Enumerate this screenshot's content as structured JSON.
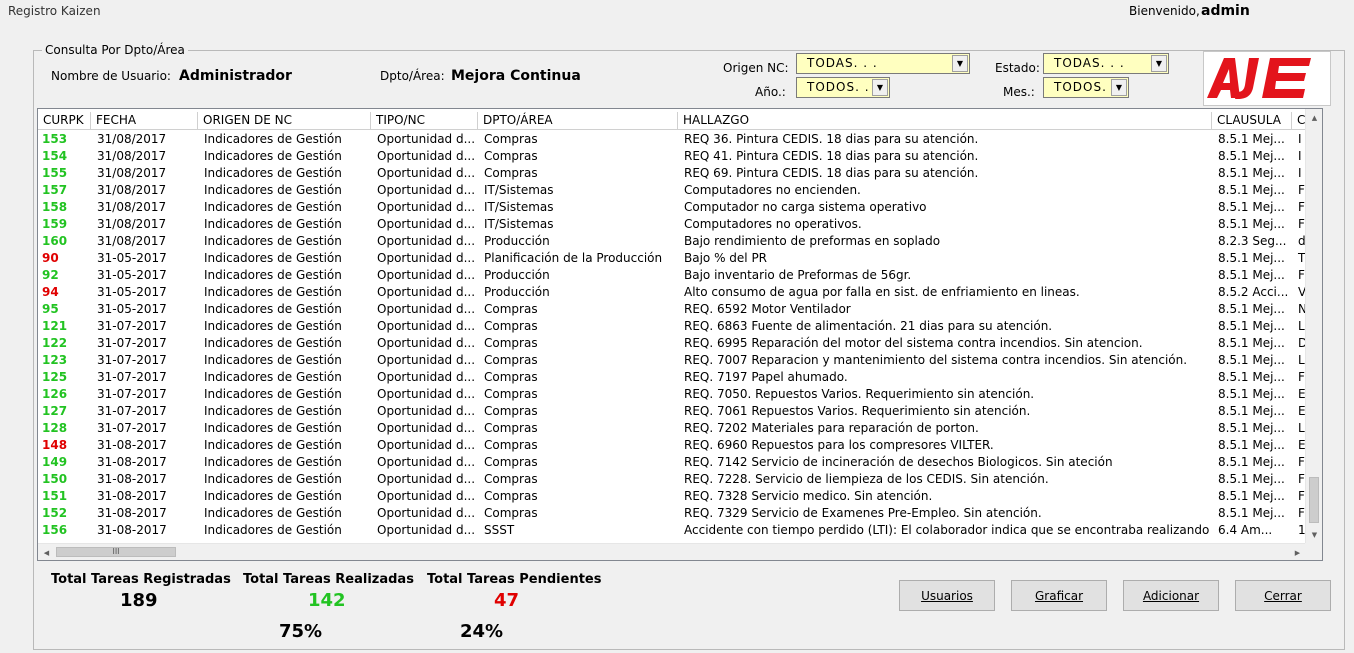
{
  "window": {
    "title": "Registro Kaizen"
  },
  "header": {
    "welcome_label": "Bienvenido,",
    "user": "admin"
  },
  "groupbox": {
    "legend": "Consulta Por Dpto/Área"
  },
  "filters": {
    "user_label": "Nombre de Usuario:",
    "user_value": "Administrador",
    "dept_label": "Dpto/Área:",
    "dept_value": "Mejora Continua",
    "origen_label": "Origen NC:",
    "origen_value": "TODAS. . .",
    "anio_label": "Año.:",
    "anio_value": "TODOS. . .",
    "estado_label": "Estado:",
    "estado_value": "TODAS. . .",
    "mes_label": "Mes.:",
    "mes_value": "TODOS. . ."
  },
  "logo": {
    "text": "AJE",
    "color": "#e3141c"
  },
  "colors": {
    "done": "#22c322",
    "pending": "#e00000",
    "combo_bg": "#ffffc0"
  },
  "table": {
    "columns": [
      "CURPK",
      "FECHA",
      "ORIGEN DE NC",
      "TIPO/NC",
      "DPTO/ÁREA",
      "HALLAZGO",
      "CLAUSULA",
      "C"
    ],
    "rows": [
      {
        "id": "153",
        "status": "done",
        "fecha": "31/08/2017",
        "origen": "Indicadores de Gestión",
        "tipo": "Oportunidad d...",
        "dpto": "Compras",
        "hallazgo": "REQ 36. Pintura CEDIS. 18 dias para su atención.",
        "clausula": "8.5.1 Mej...",
        "c": "I"
      },
      {
        "id": "154",
        "status": "done",
        "fecha": "31/08/2017",
        "origen": "Indicadores de Gestión",
        "tipo": "Oportunidad d...",
        "dpto": "Compras",
        "hallazgo": "REQ 41. Pintura CEDIS. 18 dias para su atención.",
        "clausula": "8.5.1 Mej...",
        "c": "I"
      },
      {
        "id": "155",
        "status": "done",
        "fecha": "31/08/2017",
        "origen": "Indicadores de Gestión",
        "tipo": "Oportunidad d...",
        "dpto": "Compras",
        "hallazgo": "REQ 69. Pintura CEDIS. 18 dias para su atención.",
        "clausula": "8.5.1 Mej...",
        "c": "I"
      },
      {
        "id": "157",
        "status": "done",
        "fecha": "31/08/2017",
        "origen": "Indicadores de Gestión",
        "tipo": "Oportunidad d...",
        "dpto": "IT/Sistemas",
        "hallazgo": "Computadores no encienden.",
        "clausula": "8.5.1 Mej...",
        "c": "F"
      },
      {
        "id": "158",
        "status": "done",
        "fecha": "31/08/2017",
        "origen": "Indicadores de Gestión",
        "tipo": "Oportunidad d...",
        "dpto": "IT/Sistemas",
        "hallazgo": "Computador no carga sistema operativo",
        "clausula": "8.5.1 Mej...",
        "c": "F"
      },
      {
        "id": "159",
        "status": "done",
        "fecha": "31/08/2017",
        "origen": "Indicadores de Gestión",
        "tipo": "Oportunidad d...",
        "dpto": "IT/Sistemas",
        "hallazgo": "Computadores no operativos.",
        "clausula": "8.5.1 Mej...",
        "c": "F"
      },
      {
        "id": "160",
        "status": "done",
        "fecha": "31/08/2017",
        "origen": "Indicadores de Gestión",
        "tipo": "Oportunidad d...",
        "dpto": "Producción",
        "hallazgo": "Bajo rendimiento de preformas en soplado",
        "clausula": "8.2.3 Seg...",
        "c": "d"
      },
      {
        "id": "90",
        "status": "pending",
        "fecha": "31-05-2017",
        "origen": "Indicadores de Gestión",
        "tipo": "Oportunidad d...",
        "dpto": "Planificación de la Producción",
        "hallazgo": "Bajo % del PR",
        "clausula": "8.5.1 Mej...",
        "c": "T"
      },
      {
        "id": "92",
        "status": "done",
        "fecha": "31-05-2017",
        "origen": "Indicadores de Gestión",
        "tipo": "Oportunidad d...",
        "dpto": "Producción",
        "hallazgo": "Bajo inventario de Preformas de 56gr.",
        "clausula": "8.5.1 Mej...",
        "c": "F"
      },
      {
        "id": "94",
        "status": "pending",
        "fecha": "31-05-2017",
        "origen": "Indicadores de Gestión",
        "tipo": "Oportunidad d...",
        "dpto": "Producción",
        "hallazgo": "Alto consumo de agua por falla en sist. de enfriamiento en lineas.",
        "clausula": "8.5.2 Acci...",
        "c": "V"
      },
      {
        "id": "95",
        "status": "done",
        "fecha": "31-05-2017",
        "origen": "Indicadores de Gestión",
        "tipo": "Oportunidad d...",
        "dpto": "Compras",
        "hallazgo": "REQ. 6592 Motor Ventilador",
        "clausula": "8.5.1 Mej...",
        "c": "N"
      },
      {
        "id": "121",
        "status": "done",
        "fecha": "31-07-2017",
        "origen": "Indicadores de Gestión",
        "tipo": "Oportunidad d...",
        "dpto": "Compras",
        "hallazgo": "REQ. 6863 Fuente de alimentación. 21 dias para su atención.",
        "clausula": "8.5.1 Mej...",
        "c": "L"
      },
      {
        "id": "122",
        "status": "done",
        "fecha": "31-07-2017",
        "origen": "Indicadores de Gestión",
        "tipo": "Oportunidad d...",
        "dpto": "Compras",
        "hallazgo": " REQ. 6995 Reparación del motor del sistema contra incendios. Sin atencion.",
        "clausula": "8.5.1 Mej...",
        "c": "D"
      },
      {
        "id": "123",
        "status": "done",
        "fecha": "31-07-2017",
        "origen": "Indicadores de Gestión",
        "tipo": "Oportunidad d...",
        "dpto": "Compras",
        "hallazgo": "REQ. 7007 Reparacion y mantenimiento del sistema contra incendios. Sin atención.",
        "clausula": "8.5.1 Mej...",
        "c": "L"
      },
      {
        "id": "125",
        "status": "done",
        "fecha": "31-07-2017",
        "origen": "Indicadores de Gestión",
        "tipo": "Oportunidad d...",
        "dpto": "Compras",
        "hallazgo": "REQ. 7197 Papel ahumado.",
        "clausula": "8.5.1 Mej...",
        "c": "F"
      },
      {
        "id": "126",
        "status": "done",
        "fecha": "31-07-2017",
        "origen": "Indicadores de Gestión",
        "tipo": "Oportunidad d...",
        "dpto": "Compras",
        "hallazgo": "REQ. 7050. Repuestos Varios. Requerimiento sin atención.",
        "clausula": "8.5.1 Mej...",
        "c": "E"
      },
      {
        "id": "127",
        "status": "done",
        "fecha": "31-07-2017",
        "origen": "Indicadores de Gestión",
        "tipo": "Oportunidad d...",
        "dpto": "Compras",
        "hallazgo": "REQ. 7061 Repuestos Varios. Requerimiento sin atención.",
        "clausula": "8.5.1 Mej...",
        "c": "E"
      },
      {
        "id": "128",
        "status": "done",
        "fecha": "31-07-2017",
        "origen": "Indicadores de Gestión",
        "tipo": "Oportunidad d...",
        "dpto": "Compras",
        "hallazgo": "REQ. 7202 Materiales para reparación de porton.",
        "clausula": "8.5.1 Mej...",
        "c": "L"
      },
      {
        "id": "148",
        "status": "pending",
        "fecha": "31-08-2017",
        "origen": "Indicadores de Gestión",
        "tipo": "Oportunidad d...",
        "dpto": "Compras",
        "hallazgo": "REQ. 6960 Repuestos para los compresores VILTER.",
        "clausula": "8.5.1 Mej...",
        "c": "E"
      },
      {
        "id": "149",
        "status": "done",
        "fecha": "31-08-2017",
        "origen": "Indicadores de Gestión",
        "tipo": "Oportunidad d...",
        "dpto": "Compras",
        "hallazgo": "REQ. 7142 Servicio de incineración de desechos Biologicos. Sin ateción",
        "clausula": "8.5.1 Mej...",
        "c": "F"
      },
      {
        "id": "150",
        "status": "done",
        "fecha": "31-08-2017",
        "origen": "Indicadores de Gestión",
        "tipo": "Oportunidad d...",
        "dpto": "Compras",
        "hallazgo": "REQ. 7228. Servicio de liempieza de los CEDIS. Sin atención.",
        "clausula": "8.5.1 Mej...",
        "c": "F"
      },
      {
        "id": "151",
        "status": "done",
        "fecha": "31-08-2017",
        "origen": "Indicadores de Gestión",
        "tipo": "Oportunidad d...",
        "dpto": "Compras",
        "hallazgo": "REQ. 7328 Servicio medico. Sin atención.",
        "clausula": "8.5.1 Mej...",
        "c": "F"
      },
      {
        "id": "152",
        "status": "done",
        "fecha": "31-08-2017",
        "origen": "Indicadores de Gestión",
        "tipo": "Oportunidad d...",
        "dpto": "Compras",
        "hallazgo": "REQ. 7329 Servicio de Examenes Pre-Empleo. Sin atención.",
        "clausula": "8.5.1 Mej...",
        "c": "F"
      },
      {
        "id": "156",
        "status": "done",
        "fecha": "31-08-2017",
        "origen": "Indicadores de Gestión",
        "tipo": "Oportunidad d...",
        "dpto": "SSST",
        "hallazgo": "Accidente con tiempo perdido (LTI): El colaborador indica que se encontraba realizando ...",
        "clausula": "6.4   Am...",
        "c": "1"
      }
    ]
  },
  "scroll": {
    "hthumb_grip": "III"
  },
  "stats": {
    "registered_label": "Total Tareas Registradas",
    "registered_value": "189",
    "done_label": "Total Tareas Realizadas",
    "done_value": "142",
    "done_pct": "75%",
    "pending_label": "Total Tareas Pendientes",
    "pending_value": "47",
    "pending_pct": "24%"
  },
  "buttons": {
    "usuarios": "Usuarios",
    "graficar": "Graficar",
    "adicionar": "Adicionar",
    "cerrar": "Cerrar"
  }
}
